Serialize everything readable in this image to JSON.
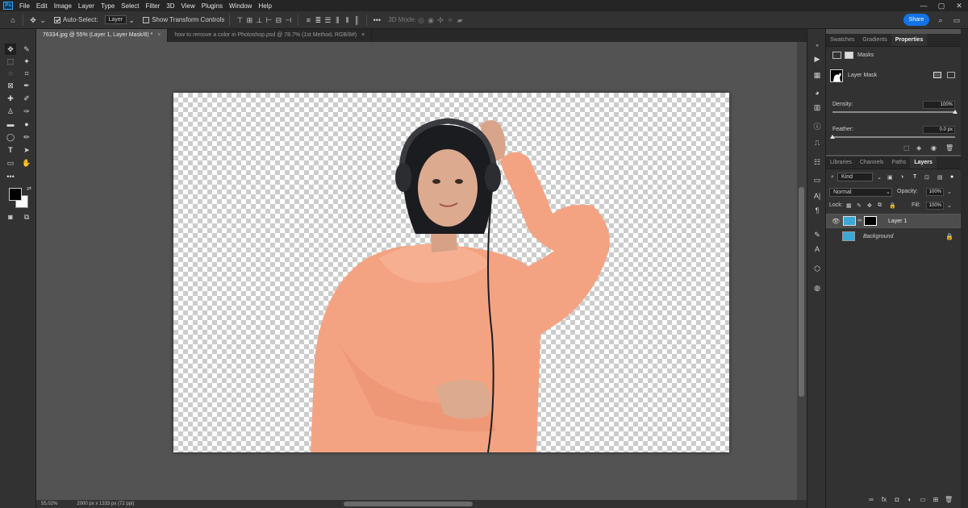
{
  "app": {
    "logo": "Ps"
  },
  "menu": [
    "File",
    "Edit",
    "Image",
    "Layer",
    "Type",
    "Select",
    "Filter",
    "3D",
    "View",
    "Plugins",
    "Window",
    "Help"
  ],
  "window_controls": {
    "minimize": "—",
    "maximize": "▢",
    "close": "✕"
  },
  "options": {
    "auto_select_label": "Auto-Select:",
    "auto_select_target": "Layer",
    "show_transform_label": "Show Transform Controls",
    "three_d_mode": "3D Mode:",
    "share": "Share"
  },
  "tabs": [
    {
      "label": "76334.jpg @ 55% (Layer 1, Layer Mask/8) *",
      "close": "×"
    },
    {
      "label": "how to remove a color in Photoshop.psd @ 78.7% (1st Method, RGB/8#)",
      "close": "×"
    }
  ],
  "status": {
    "zoom": "55.02%",
    "doc_info": "2000 px x 1333 px (72 ppi)"
  },
  "properties": {
    "tabs": [
      "Swatches",
      "Gradients",
      "Properties"
    ],
    "masks_label": "Masks",
    "layer_mask_label": "Layer Mask",
    "density_label": "Density:",
    "density_value": "100%",
    "density_level": 1.0,
    "feather_label": "Feather:",
    "feather_value": "0.0 px",
    "feather_level": 0.0
  },
  "layers": {
    "tabs": [
      "Libraries",
      "Channels",
      "Paths",
      "Layers"
    ],
    "filter_kind": "Kind",
    "blend_mode": "Normal",
    "opacity_label": "Opacity:",
    "opacity_value": "100%",
    "lock_label": "Lock:",
    "fill_label": "Fill:",
    "fill_value": "100%",
    "items": [
      {
        "name": "Layer 1"
      },
      {
        "name": "Background"
      }
    ],
    "bottom_icons": [
      "∞",
      "fx",
      "◘",
      "◐",
      "▭",
      "⊞",
      "🗑"
    ]
  },
  "colors": {
    "accent": "#1473e6",
    "panel": "#323232",
    "workspace": "#535353"
  }
}
